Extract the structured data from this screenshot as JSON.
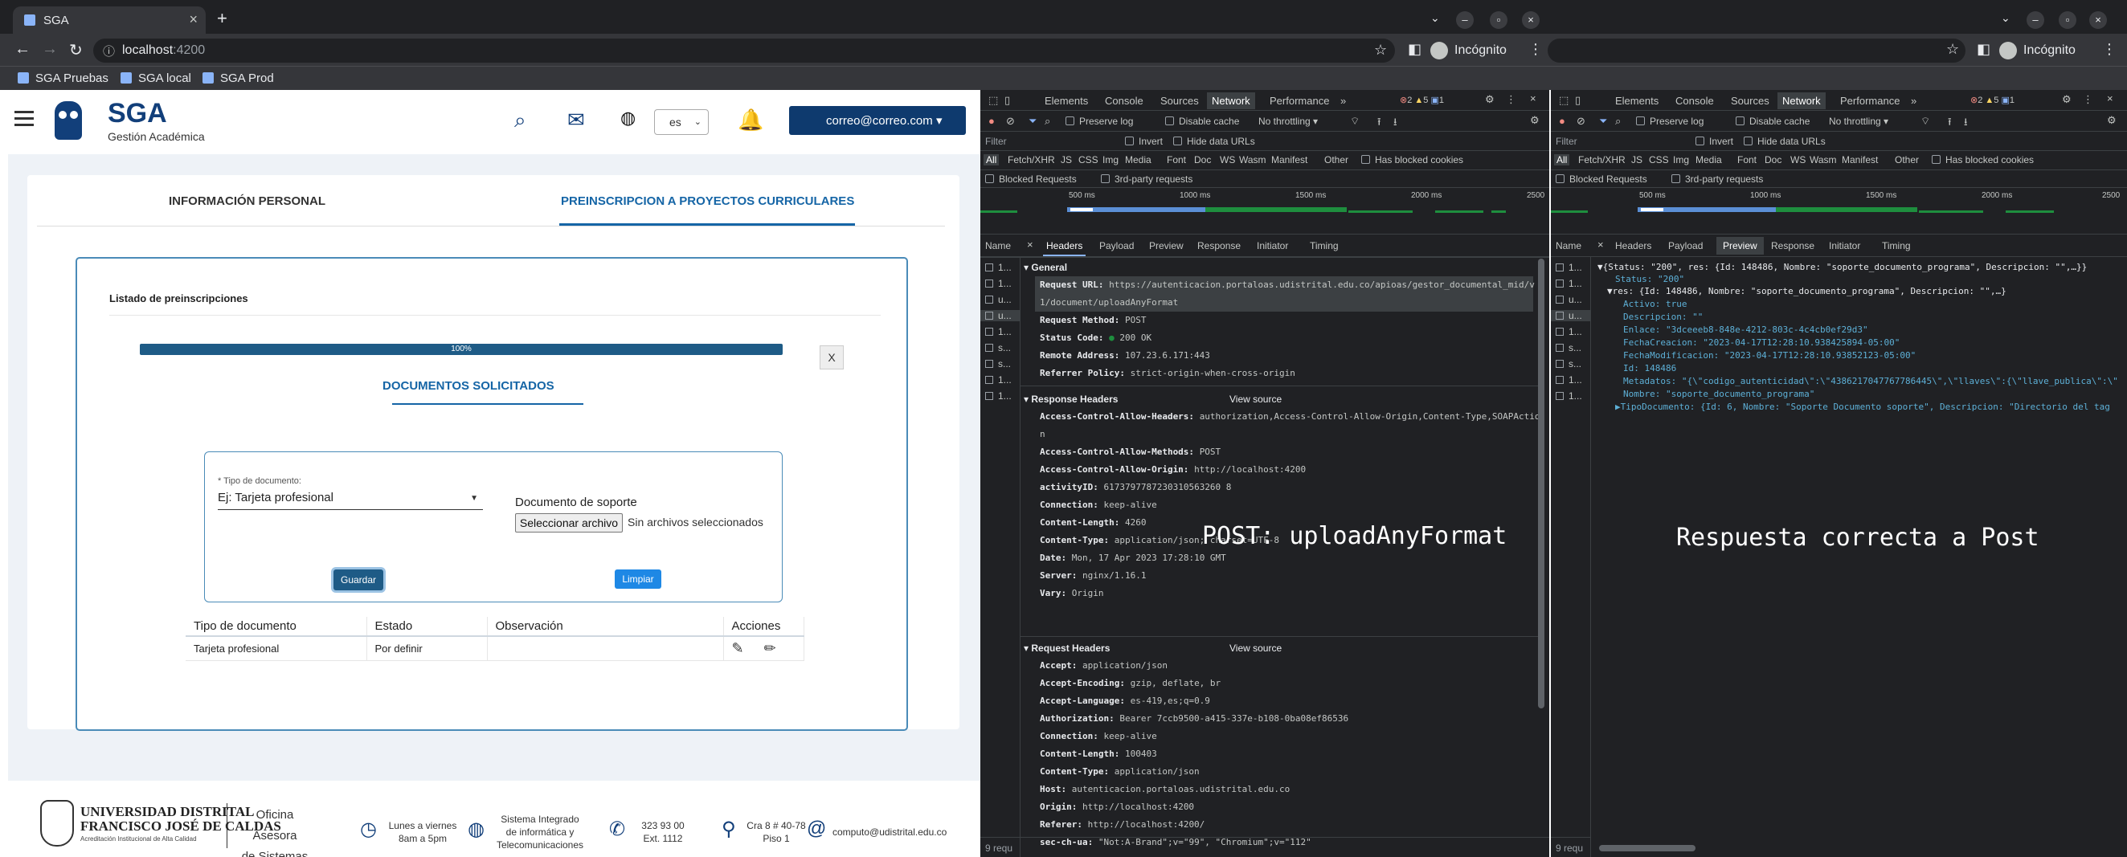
{
  "browser": {
    "tab_title": "SGA",
    "new_tab": "+",
    "url_host": "localhost",
    "url_port": ":4200",
    "incognito_label": "Incógnito",
    "bookmarks": [
      "SGA Pruebas",
      "SGA local",
      "SGA Prod"
    ]
  },
  "app": {
    "brand": "SGA",
    "brand_sub": "Gestión Académica",
    "lang": "es",
    "user_email": "correo@correo.com",
    "tabs": [
      "INFORMACIÓN PERSONAL",
      "PREINSCRIPCION A PROYECTOS CURRICULARES"
    ],
    "list_title": "Listado de preinscripciones",
    "progress_text": "100%",
    "progress_value": 100,
    "close_label": "X",
    "doc_section_title": "DOCUMENTOS SOLICITADOS",
    "form": {
      "type_label": "* Tipo de documento:",
      "type_value": "Ej: Tarjeta profesional",
      "support_label": "Documento de soporte",
      "file_button": "Seleccionar archivo",
      "file_status": "Sin archivos seleccionados",
      "save": "Guardar",
      "clear": "Limpiar"
    },
    "table": {
      "headers": [
        "Tipo de documento",
        "Estado",
        "Observación",
        "Acciones"
      ],
      "rows": [
        [
          "Tarjeta profesional",
          "Por definir",
          ""
        ]
      ]
    }
  },
  "footer": {
    "university_l1": "UNIVERSIDAD DISTRITAL",
    "university_l2": "FRANCISCO JOSÉ DE CALDAS",
    "university_sub": "Acreditación Institucional de Alta Calidad",
    "office_l1": "Oficina Asesora",
    "office_l2": "de Sistemas",
    "hours_l1": "Lunes a viernes",
    "hours_l2": "8am a 5pm",
    "system_l1": "Sistema Integrado",
    "system_l2": "de informática y",
    "system_l3": "Telecomunicaciones",
    "phone_l1": "323 93 00",
    "phone_l2": "Ext. 1112",
    "address_l1": "Cra 8 # 40-78",
    "address_l2": "Piso 1",
    "email": "computo@udistrital.edu.co"
  },
  "devtools": {
    "panels": [
      "Elements",
      "Console",
      "Sources",
      "Network",
      "Performance",
      "»"
    ],
    "badges": {
      "errors": "2",
      "warnings": "5",
      "info": "1"
    },
    "preserve_log": "Preserve log",
    "disable_cache": "Disable cache",
    "throttling": "No throttling",
    "filter_placeholder": "Filter",
    "invert": "Invert",
    "hide_data_urls": "Hide data URLs",
    "types": [
      "All",
      "Fetch/XHR",
      "JS",
      "CSS",
      "Img",
      "Media",
      "Font",
      "Doc",
      "WS",
      "Wasm",
      "Manifest",
      "Other"
    ],
    "has_blocked_cookies": "Has blocked cookies",
    "blocked_requests": "Blocked Requests",
    "third_party": "3rd-party requests",
    "timeline_ticks": [
      "500 ms",
      "1000 ms",
      "1500 ms",
      "2000 ms",
      "2500"
    ],
    "name_col": "Name",
    "detail_tabs": [
      "Headers",
      "Payload",
      "Preview",
      "Response",
      "Initiator",
      "Timing"
    ],
    "name_rows": [
      "1...",
      "1...",
      "u...",
      "u...",
      "1...",
      "s...",
      "s...",
      "1...",
      "1..."
    ],
    "requests_status": "9 requ",
    "general_title": "General",
    "request_url_key": "Request URL:",
    "request_url_l1": "https://autenticacion.portaloas.udistrital.edu.co/apioas/gestor_documental_mid/v",
    "request_url_l2": "1/document/uploadAnyFormat",
    "method_key": "Request Method:",
    "method_val": "POST",
    "status_key": "Status Code:",
    "status_val": "200 OK",
    "remote_key": "Remote Address:",
    "remote_val": "107.23.6.171:443",
    "referrer_key": "Referrer Policy:",
    "referrer_val": "strict-origin-when-cross-origin",
    "response_headers_title": "Response Headers",
    "request_headers_title": "Request Headers",
    "view_source": "View source",
    "response_headers": [
      [
        "Access-Control-Allow-Headers:",
        "authorization,Access-Control-Allow-Origin,Content-Type,SOAPActio"
      ],
      [
        "",
        "n"
      ],
      [
        "Access-Control-Allow-Methods:",
        "POST"
      ],
      [
        "Access-Control-Allow-Origin:",
        "http://localhost:4200"
      ],
      [
        "activityID:",
        "6173797787230310563260 8"
      ],
      [
        "Connection:",
        "keep-alive"
      ],
      [
        "Content-Length:",
        "4260"
      ],
      [
        "Content-Type:",
        "application/json; charset=UTF-8"
      ],
      [
        "Date:",
        "Mon, 17 Apr 2023 17:28:10 GMT"
      ],
      [
        "Server:",
        "nginx/1.16.1"
      ],
      [
        "Vary:",
        "Origin"
      ]
    ],
    "request_headers": [
      [
        "Accept:",
        "application/json"
      ],
      [
        "Accept-Encoding:",
        "gzip, deflate, br"
      ],
      [
        "Accept-Language:",
        "es-419,es;q=0.9"
      ],
      [
        "Authorization:",
        "Bearer 7ccb9500-a415-337e-b108-0ba08ef86536"
      ],
      [
        "Connection:",
        "keep-alive"
      ],
      [
        "Content-Length:",
        "100403"
      ],
      [
        "Content-Type:",
        "application/json"
      ],
      [
        "Host:",
        "autenticacion.portaloas.udistrital.edu.co"
      ],
      [
        "Origin:",
        "http://localhost:4200"
      ],
      [
        "Referer:",
        "http://localhost:4200/"
      ],
      [
        "sec-ch-ua:",
        "\"Not:A-Brand\";v=\"99\", \"Chromium\";v=\"112\""
      ]
    ],
    "annotation_left": "POST: uploadAnyFormat",
    "annotation_right": "Respuesta correcta a Post",
    "preview_lines": [
      "▼{Status: \"200\", res: {Id: 148486, Nombre: \"soporte_documento_programa\", Descripcion: \"\",…}}",
      "Status: \"200\"",
      "▼res: {Id: 148486, Nombre: \"soporte_documento_programa\", Descripcion: \"\",…}",
      "Activo: true",
      "Descripcion: \"\"",
      "Enlace: \"3dceeeb8-848e-4212-803c-4c4cb0ef29d3\"",
      "FechaCreacion: \"2023-04-17T12:28:10.938425894-05:00\"",
      "FechaModificacion: \"2023-04-17T12:28:10.93852123-05:00\"",
      "Id: 148486",
      "Metadatos: \"{\\\"codigo_autenticidad\\\":\\\"4386217047767786445\\\",\\\"llaves\\\":{\\\"llave_publica\\\":\\\"",
      "Nombre: \"soporte_documento_programa\"",
      "▶TipoDocumento: {Id: 6, Nombre: \"Soporte Documento soporte\", Descripcion: \"Directorio del tag"
    ]
  }
}
